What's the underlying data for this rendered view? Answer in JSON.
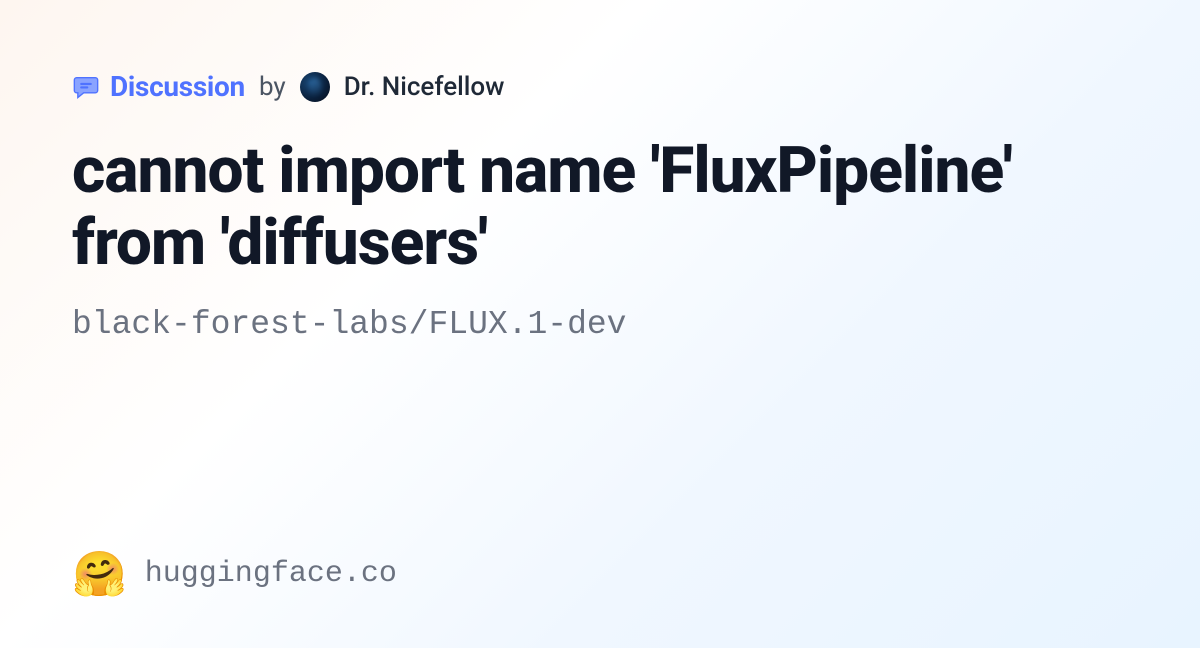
{
  "header": {
    "discussion_label": "Discussion",
    "by_text": "by",
    "author_name": "Dr. Nicefellow"
  },
  "title": "cannot import name 'FluxPipeline' from 'diffusers'",
  "repo_path": "black-forest-labs/FLUX.1-dev",
  "footer": {
    "logo_emoji": "🤗",
    "site_name": "huggingface.co"
  }
}
